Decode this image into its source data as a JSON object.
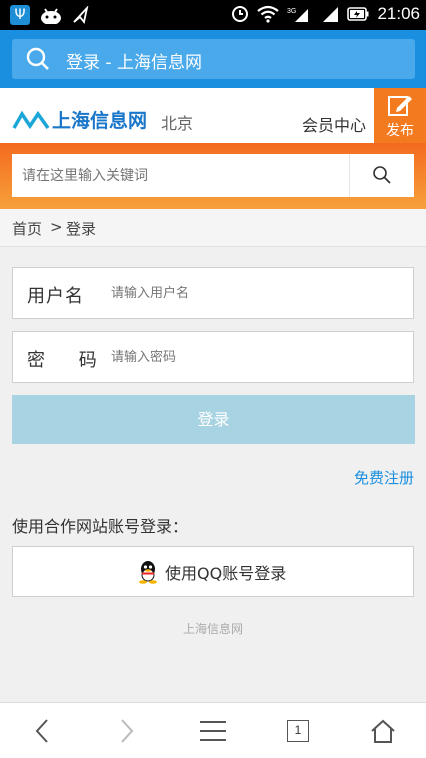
{
  "status_bar": {
    "time": "21:06"
  },
  "url_bar": {
    "title": "登录 - 上海信息网"
  },
  "site_header": {
    "logo_text": "上海信息网",
    "city": "北京",
    "member_center": "会员中心",
    "publish_label": "发布"
  },
  "search": {
    "placeholder": "请在这里输入关键词"
  },
  "breadcrumb": {
    "home": "首页",
    "separator": ">",
    "current": "登录"
  },
  "login_form": {
    "username_label": "用户名",
    "username_placeholder": "请输入用户名",
    "password_label": "密 码",
    "password_placeholder": "请输入密码",
    "login_button": "登录",
    "register_link": "免费注册",
    "partner_login_text": "使用合作网站账号登录：",
    "qq_login_button": "使用QQ账号登录"
  },
  "footer": {
    "text": "上海信息网"
  },
  "bottom_nav": {
    "tab_count": "1"
  },
  "colors": {
    "accent_blue": "#1a8fe0",
    "orange": "#f47a20",
    "login_button": "#a8d3e2"
  }
}
